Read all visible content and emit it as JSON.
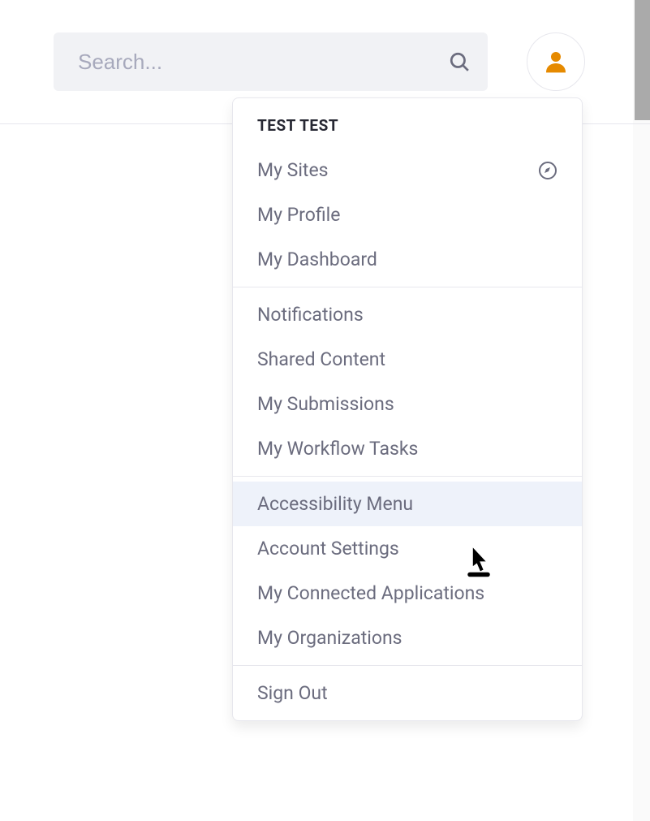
{
  "search": {
    "placeholder": "Search..."
  },
  "user": {
    "name": "TEST TEST"
  },
  "menu": {
    "sections": [
      {
        "items": [
          {
            "label": "My Sites",
            "has_compass_icon": true
          },
          {
            "label": "My Profile"
          },
          {
            "label": "My Dashboard"
          }
        ]
      },
      {
        "items": [
          {
            "label": "Notifications"
          },
          {
            "label": "Shared Content"
          },
          {
            "label": "My Submissions"
          },
          {
            "label": "My Workflow Tasks"
          }
        ]
      },
      {
        "items": [
          {
            "label": "Accessibility Menu",
            "highlighted": true
          },
          {
            "label": "Account Settings"
          },
          {
            "label": "My Connected Applications"
          },
          {
            "label": "My Organizations"
          }
        ]
      },
      {
        "items": [
          {
            "label": "Sign Out"
          }
        ]
      }
    ]
  }
}
